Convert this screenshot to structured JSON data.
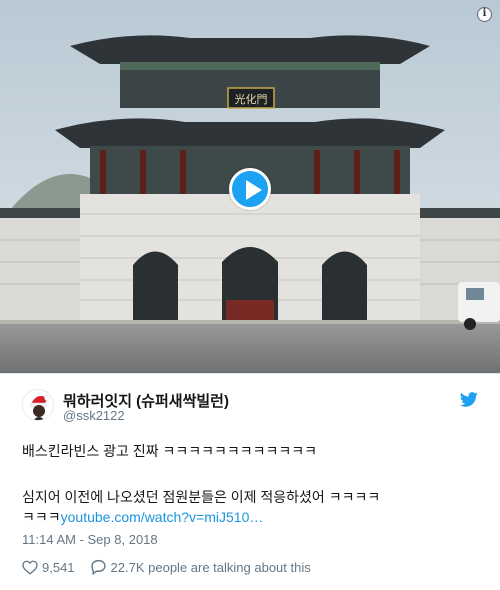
{
  "media": {
    "signboard_text": "光化門",
    "info_icon": "info-icon",
    "play_icon": "play-icon"
  },
  "author": {
    "display_name": "뭐하러잇지 (슈퍼새싹빌런)",
    "handle": "@ssk2122",
    "avatar_icon": "santa-avatar-icon"
  },
  "tweet": {
    "line1": "배스킨라빈스 광고 진짜 ㅋㅋㅋㅋㅋㅋㅋㅋㅋㅋㅋㅋ",
    "line2": "심지어 이전에 나오셨던 점원분들은 이제 적응하셨어 ㅋㅋㅋㅋ",
    "line3_prefix": "ㅋㅋㅋ",
    "link": "youtube.com/watch?v=miJ510…"
  },
  "timestamp": "11:14 AM - Sep 8, 2018",
  "stats": {
    "likes": "9,541",
    "talking": "22.7K people are talking about this"
  },
  "colors": {
    "link": "#1b95e0",
    "brand": "#1da1f2",
    "muted": "#657786",
    "text": "#14171a"
  }
}
